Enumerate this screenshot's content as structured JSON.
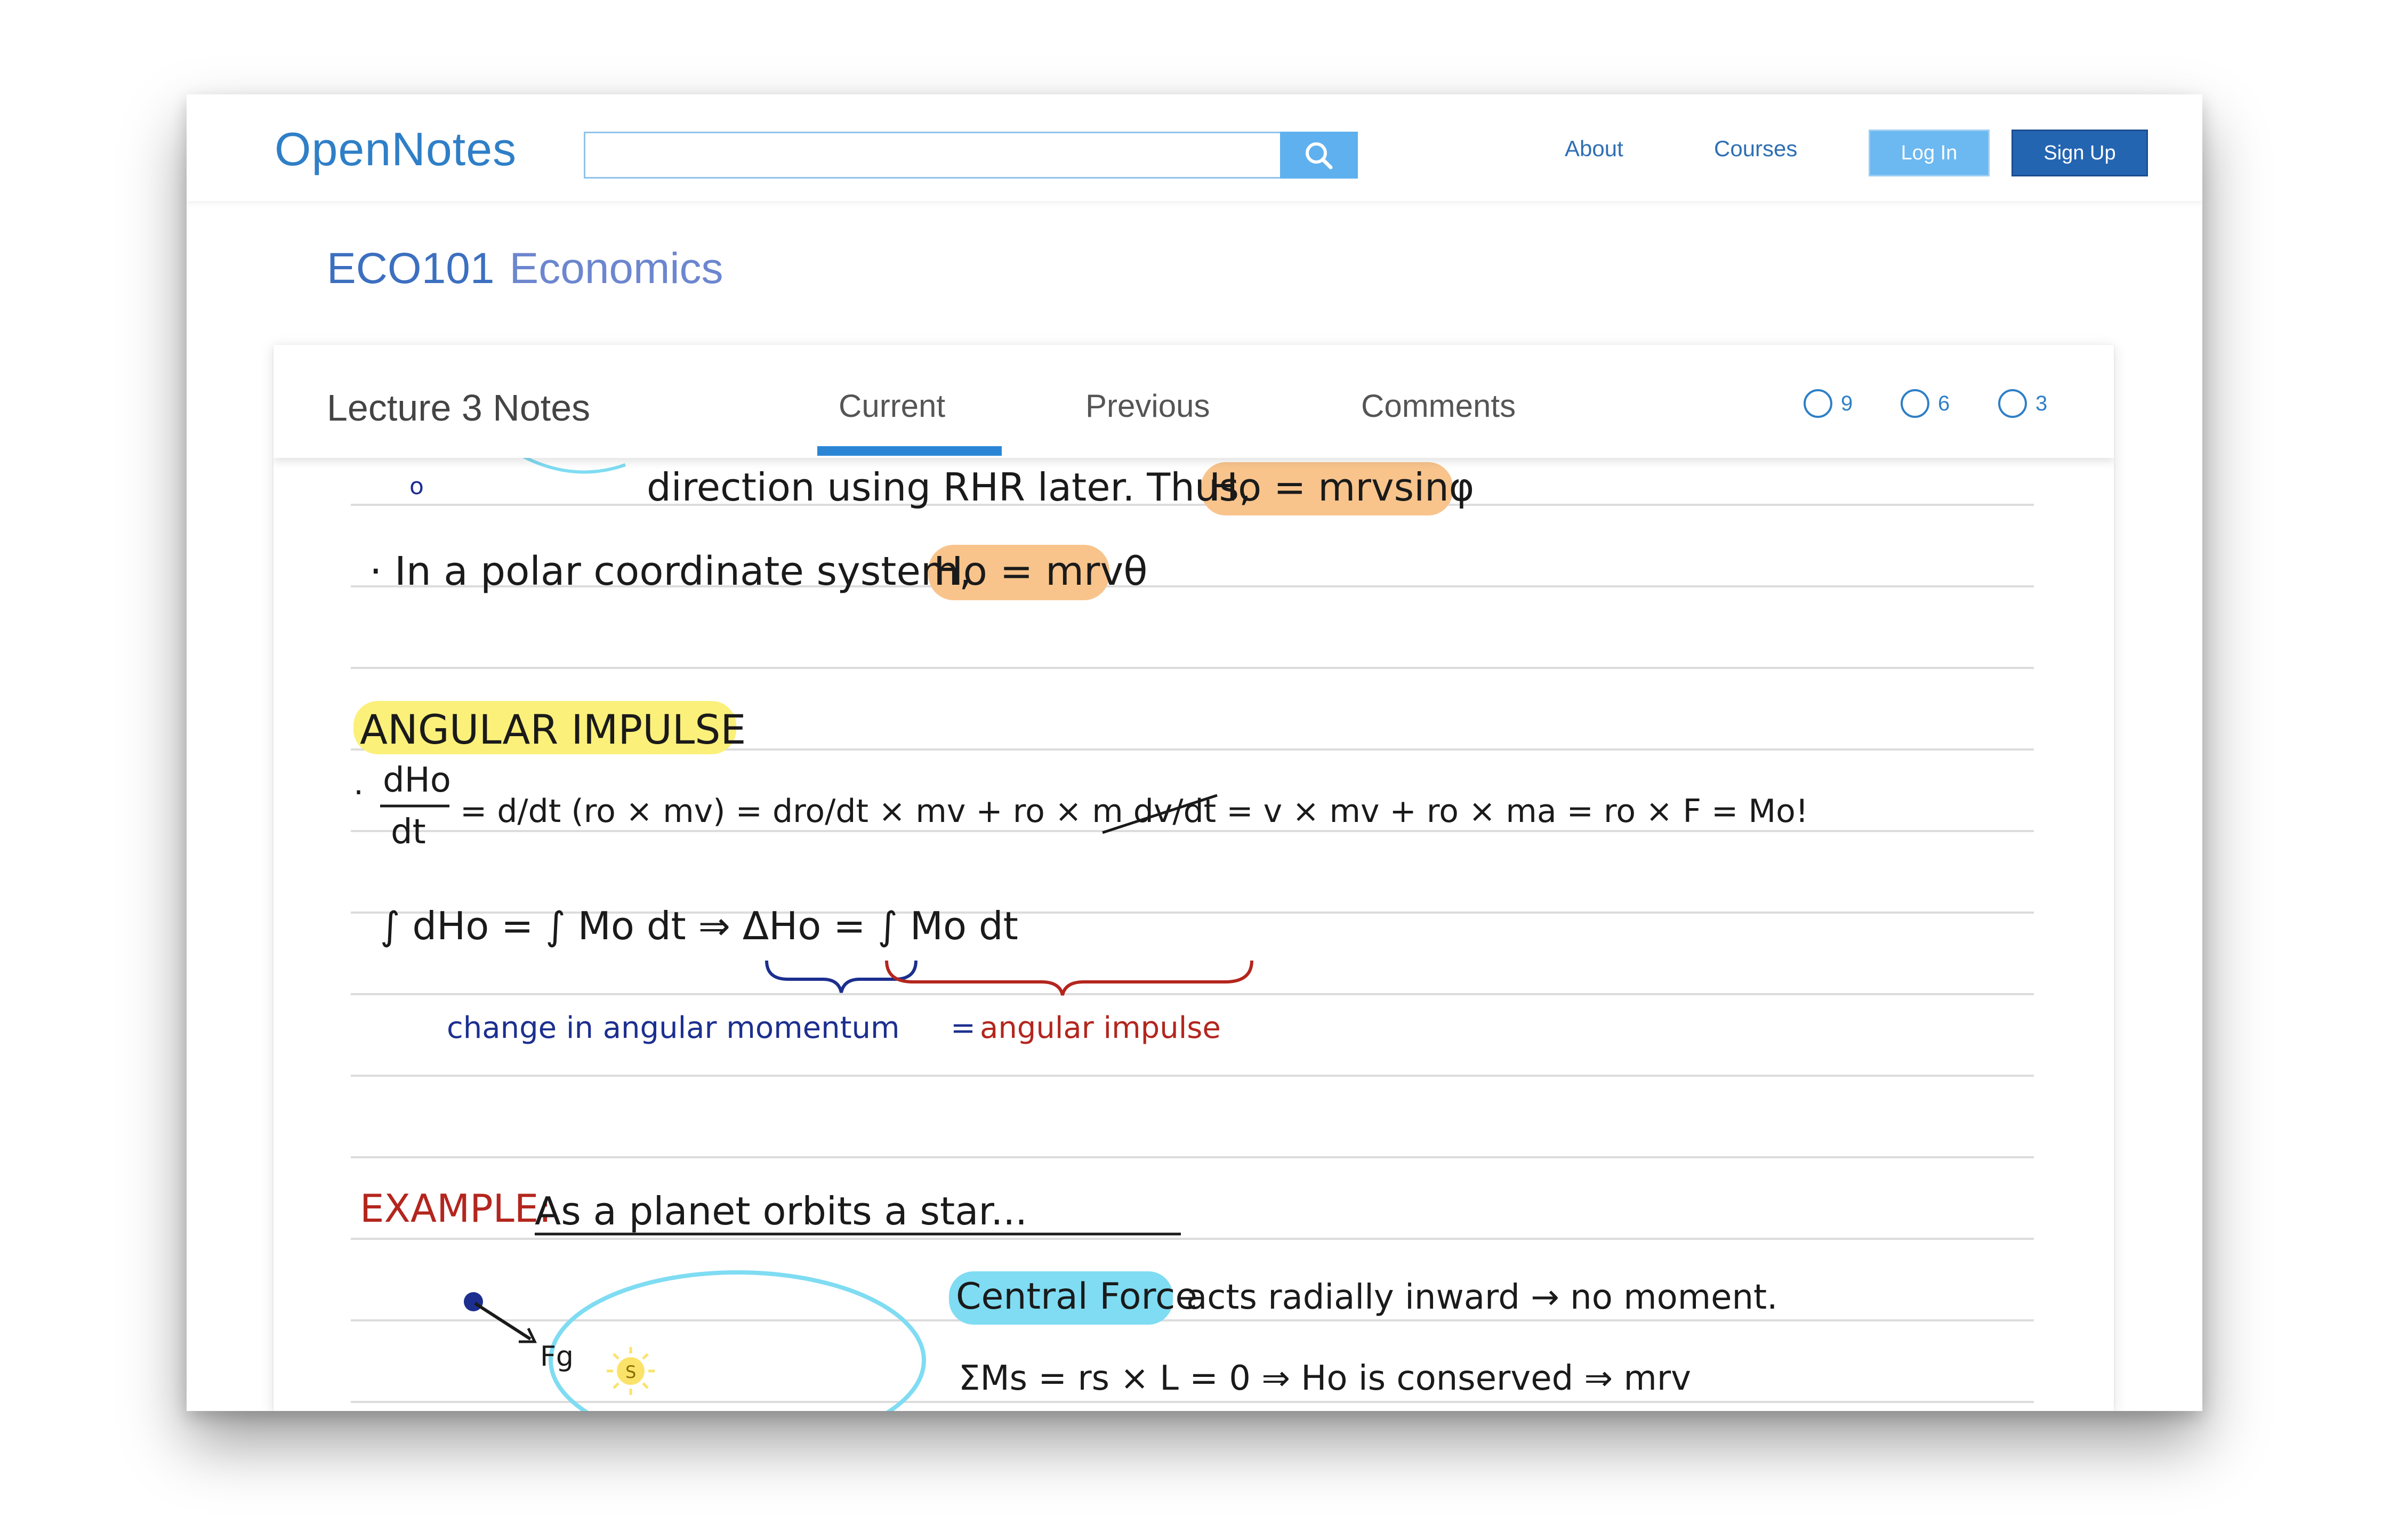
{
  "app": {
    "logo": "OpenNotes",
    "search": {
      "placeholder": "",
      "icon": "search-icon"
    },
    "nav": {
      "about": "About",
      "courses": "Courses"
    },
    "buttons": {
      "login": "Log In",
      "signup": "Sign Up"
    }
  },
  "course": {
    "code": "ECO101",
    "name": "Economics"
  },
  "card": {
    "title": "Lecture 3 Notes",
    "tabs": [
      {
        "label": "Current",
        "active": true
      },
      {
        "label": "Previous",
        "active": false
      },
      {
        "label": "Comments",
        "active": false
      }
    ],
    "counters": [
      "9",
      "6",
      "3"
    ]
  },
  "notes": {
    "top_fragment": "o",
    "line1": "direction using RHR later. Thus,",
    "line1_eq": "Ho = mrvsinφ",
    "line2": "· In a polar coordinate system,",
    "line2_eq": "Ho = mrvθ",
    "heading": "ANGULAR IMPULSE",
    "eq1_mid": "= d/dt (ro × mv) = dro/dt × mv + ro × m dv/dt = v × mv + ro × ma = ro × F = Mo!",
    "eq2": "∫ dHo = ∫ Mo dt  ⇒  ΔHo = ∫ Mo dt",
    "brace_left": "change in angular momentum",
    "brace_eq": "=",
    "brace_right": "angular impulse",
    "example_label": "EXAMPLE:",
    "example_text": "As a planet orbits a star...",
    "central_force": "Central Force",
    "central_rest": "acts radially inward → no moment.",
    "moment_eq": "ΣMs = rs × L = 0 ⇒ Ho is conserved ⇒ mrv",
    "fg_label": "Fg",
    "sun_label": "S"
  },
  "colors": {
    "brand": "#2f7fc7",
    "orange_highlight": "#f8c48c",
    "yellow_highlight": "#fbf07a",
    "cyan_highlight": "#7fdcf2",
    "blue_ink": "#1c2f8f",
    "red_ink": "#b3261e"
  }
}
